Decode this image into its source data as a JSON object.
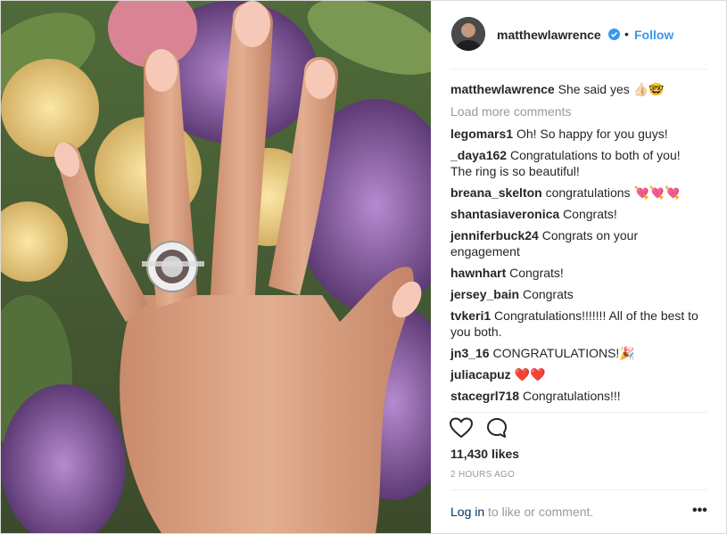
{
  "post": {
    "username": "matthewlawrence",
    "follow_label": "Follow",
    "separator": "•",
    "caption_user": "matthewlawrence",
    "caption_text": "She said yes 👍🏻🤓",
    "load_more": "Load more comments",
    "comments": [
      {
        "user": "legomars1",
        "text": "Oh! So happy for you guys!"
      },
      {
        "user": "_daya162",
        "text": "Congratulations to both of you! The ring is so beautiful!"
      },
      {
        "user": "breana_skelton",
        "text": "congratulations 💘💘💘"
      },
      {
        "user": "shantasiaveronica",
        "text": "Congrats!"
      },
      {
        "user": "jenniferbuck24",
        "text": "Congrats on your engagement"
      },
      {
        "user": "hawnhart",
        "text": "Congrats!"
      },
      {
        "user": "jersey_bain",
        "text": "Congrats"
      },
      {
        "user": "tvkeri1",
        "text": "Congratulations!!!!!!! All of the best to you both."
      },
      {
        "user": "jn3_16",
        "text": "CONGRATULATIONS!🎉"
      },
      {
        "user": "juliacapuz",
        "text": "❤️❤️"
      },
      {
        "user": "stacegrl718",
        "text": "Congratulations!!!"
      }
    ],
    "likes": "11,430 likes",
    "time": "2 HOURS AGO",
    "login_link": "Log in",
    "login_rest": " to like or comment.",
    "more_options": "•••",
    "icons": {
      "like": "heart-icon",
      "comment": "comment-icon",
      "verified": "verified-badge-icon",
      "more": "more-options-icon"
    },
    "colors": {
      "link_blue": "#3897f0",
      "muted": "#999999",
      "text": "#262626",
      "login_link": "#003569"
    }
  }
}
